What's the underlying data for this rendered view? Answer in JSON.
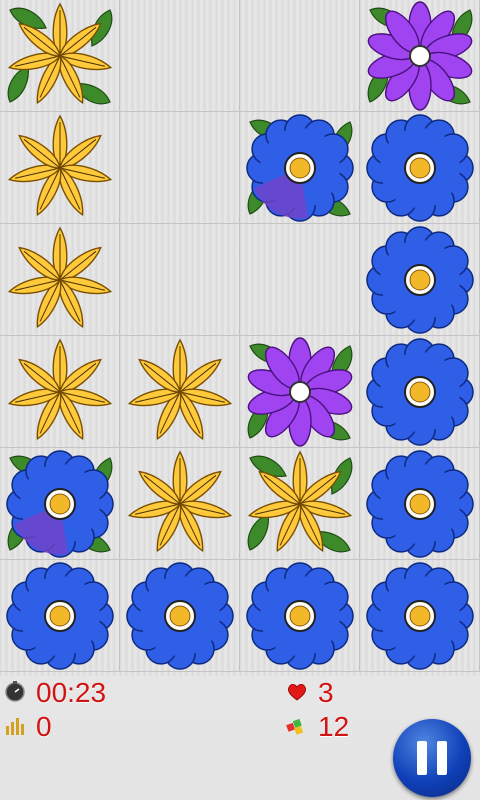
{
  "board": {
    "columns": 4,
    "rows": 6,
    "tiles": [
      [
        "yellow-star-flower-leaves",
        "empty",
        "empty",
        "purple-daisy-leaves"
      ],
      [
        "yellow-star-flower",
        "empty",
        "blue-flower-leaves-timer",
        "blue-flower"
      ],
      [
        "yellow-star-flower",
        "empty",
        "empty",
        "blue-flower"
      ],
      [
        "yellow-star-flower",
        "yellow-star-flower",
        "purple-daisy-leaves",
        "blue-flower"
      ],
      [
        "blue-flower-leaves-timer",
        "yellow-star-flower",
        "yellow-star-flower-leaves",
        "blue-flower"
      ],
      [
        "blue-flower",
        "blue-flower",
        "blue-flower",
        "blue-flower"
      ]
    ]
  },
  "hud": {
    "timer_icon": "stopwatch-icon",
    "timer": "00:23",
    "score_icon": "bar-chart-icon",
    "score": "0",
    "lives_icon": "heart-icon",
    "lives": "3",
    "moves_icon": "blocks-icon",
    "moves": "12",
    "pause_icon": "pause-icon"
  },
  "colors": {
    "hud_text": "#d01414",
    "yellow_petal": "#ffc93c",
    "blue_petal": "#2f5fe6",
    "purple_petal": "#a043f0",
    "leaf": "#3d8a2a",
    "pause_button": "#1040b8"
  }
}
